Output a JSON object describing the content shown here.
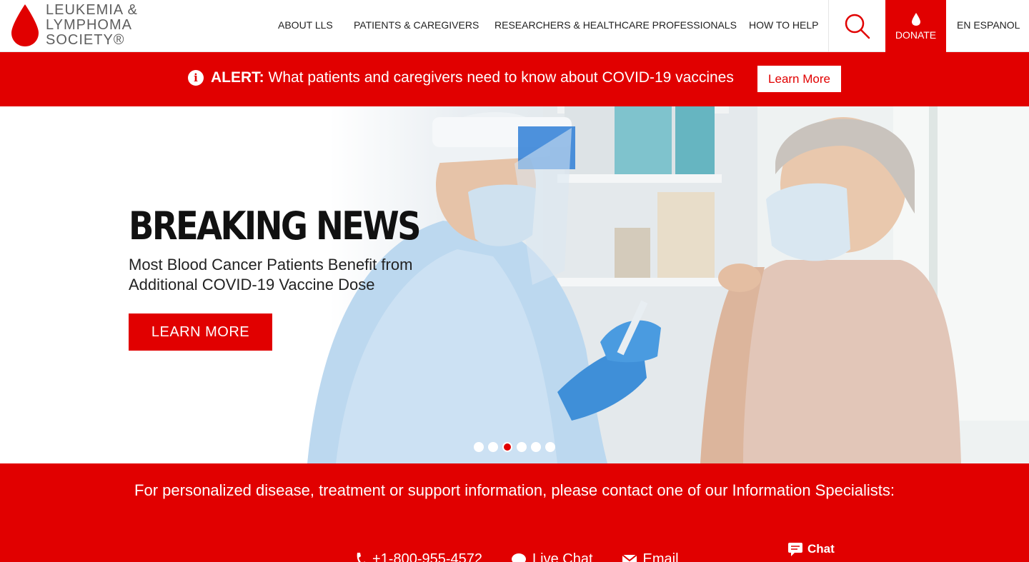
{
  "logo": {
    "line1": "LEUKEMIA &",
    "line2": "LYMPHOMA",
    "line3": "SOCIETY®"
  },
  "nav": {
    "items": [
      "ABOUT LLS",
      "PATIENTS & CAREGIVERS",
      "RESEARCHERS & HEALTHCARE PROFESSIONALS",
      "HOW TO HELP"
    ],
    "donate_label": "DONATE",
    "espanol_label": "EN ESPANOL"
  },
  "alert": {
    "prefix": "ALERT:",
    "message": " What patients and caregivers need to know about COVID-19 vaccines",
    "button_label": "Learn More"
  },
  "hero": {
    "title": "BREAKING NEWS",
    "subtitle": "Most Blood Cancer Patients Benefit from Additional COVID-19 Vaccine Dose",
    "button_label": "LEARN MORE",
    "carousel_total": 6,
    "carousel_active": 3
  },
  "contact": {
    "text": "For personalized disease, treatment or support information, please contact one of our Information Specialists:",
    "phone": "+1-800-955-4572",
    "live_chat": "Live Chat",
    "email": "Email",
    "chat_label": "Chat"
  },
  "colors": {
    "brand_red": "#e10000",
    "text_dark": "#222222",
    "logo_gray": "#5e5e5e"
  }
}
